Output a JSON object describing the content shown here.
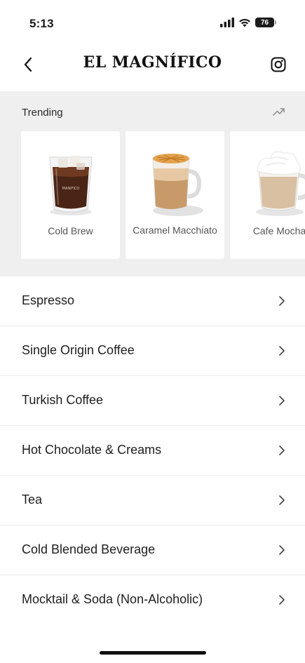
{
  "status": {
    "time": "5:13",
    "battery": "76"
  },
  "header": {
    "title": "EL MAGNÍFICO",
    "back_icon": "chevron-left-icon",
    "social_icon": "instagram-icon"
  },
  "trending": {
    "label": "Trending",
    "icon": "trending-up-icon",
    "items": [
      {
        "name": "Cold Brew"
      },
      {
        "name": "Caramel Macchiato"
      },
      {
        "name": "Cafe Mocha"
      }
    ]
  },
  "categories": [
    {
      "label": "Espresso"
    },
    {
      "label": "Single Origin Coffee"
    },
    {
      "label": "Turkish Coffee"
    },
    {
      "label": "Hot Chocolate & Creams"
    },
    {
      "label": "Tea"
    },
    {
      "label": "Cold Blended Beverage"
    },
    {
      "label": "Mocktail & Soda (Non-Alcoholic)"
    }
  ],
  "colors": {
    "trending_bg": "#efefef",
    "text": "#1b1b1b",
    "divider": "#ececec"
  }
}
